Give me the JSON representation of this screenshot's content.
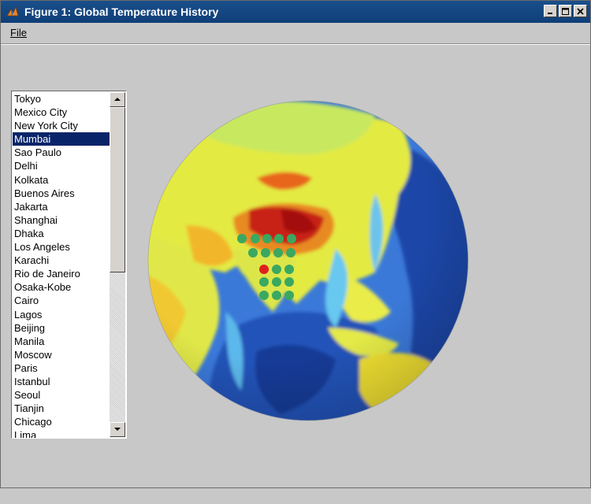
{
  "window": {
    "title": "Figure 1: Global Temperature History",
    "buttons": [
      "minimize-icon",
      "maximize-icon",
      "close-icon"
    ]
  },
  "menu": {
    "file_label": "File"
  },
  "city_list": {
    "selected": "Mumbai",
    "items": [
      "Tokyo",
      "Mexico City",
      "New York City",
      "Mumbai",
      "Sao Paulo",
      "Delhi",
      "Kolkata",
      "Buenos Aires",
      "Jakarta",
      "Shanghai",
      "Dhaka",
      "Los Angeles",
      "Karachi",
      "Rio de Janeiro",
      "Osaka-Kobe",
      "Cairo",
      "Lagos",
      "Beijing",
      "Manila",
      "Moscow",
      "Paris",
      "Istanbul",
      "Seoul",
      "Tianjin",
      "Chicago",
      "Lima"
    ]
  },
  "globe": {
    "center_region": "South Asia",
    "marker_colors": {
      "grid": "#3aa860",
      "selected": "#e02020"
    },
    "colormap": [
      "#0b2a8a",
      "#3a6fd8",
      "#5cc8f0",
      "#e8ee40",
      "#f08a18",
      "#b01010"
    ]
  }
}
